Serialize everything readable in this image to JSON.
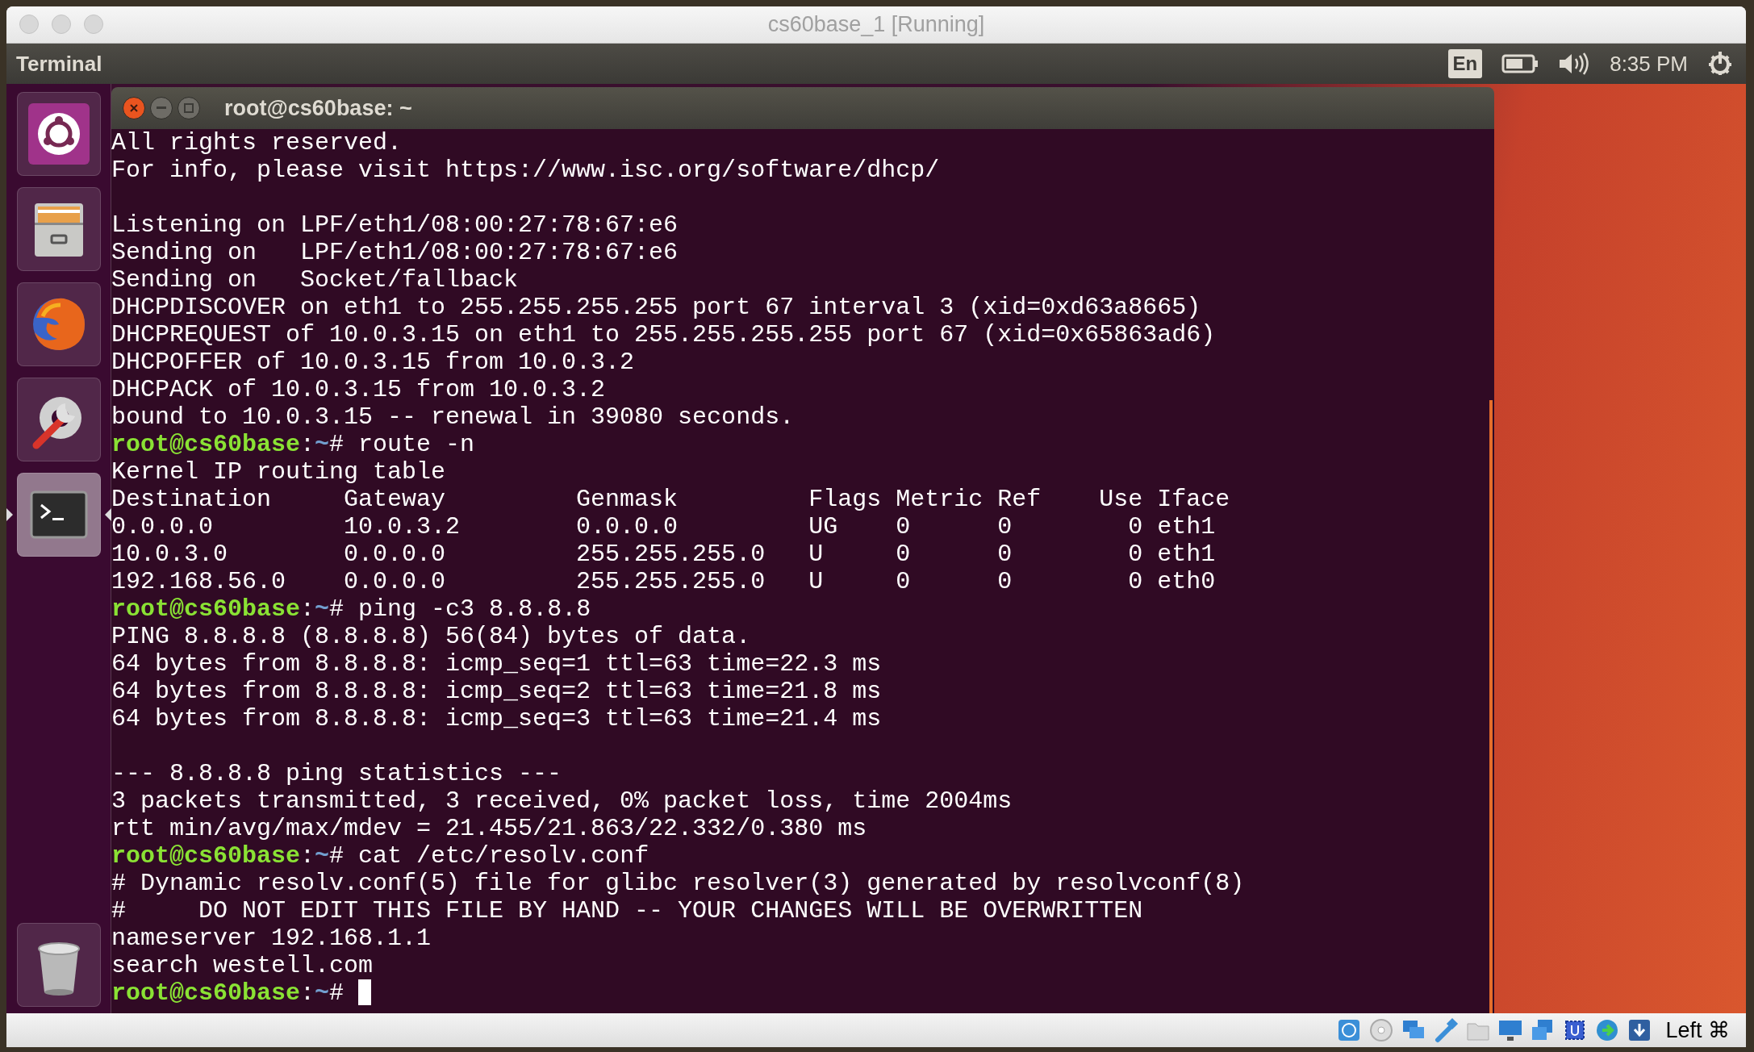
{
  "window": {
    "title": "cs60base_1 [Running]"
  },
  "top_panel": {
    "app_name": "Terminal",
    "keyboard": "En",
    "time": "8:35 PM"
  },
  "launcher": {
    "items": [
      {
        "kind": "dash",
        "selected": false
      },
      {
        "kind": "files",
        "selected": false
      },
      {
        "kind": "browser",
        "selected": false
      },
      {
        "kind": "settings",
        "selected": false
      },
      {
        "kind": "terminal",
        "selected": true
      },
      {
        "kind": "trash",
        "selected": false
      }
    ]
  },
  "terminal": {
    "title": "root@cs60base: ~",
    "lines": [
      {
        "kind": "output",
        "text": "All rights reserved."
      },
      {
        "kind": "output",
        "text": "For info, please visit https://www.isc.org/software/dhcp/"
      },
      {
        "kind": "blank"
      },
      {
        "kind": "output",
        "text": "Listening on LPF/eth1/08:00:27:78:67:e6"
      },
      {
        "kind": "output",
        "text": "Sending on   LPF/eth1/08:00:27:78:67:e6"
      },
      {
        "kind": "output",
        "text": "Sending on   Socket/fallback"
      },
      {
        "kind": "output",
        "text": "DHCPDISCOVER on eth1 to 255.255.255.255 port 67 interval 3 (xid=0xd63a8665)"
      },
      {
        "kind": "output",
        "text": "DHCPREQUEST of 10.0.3.15 on eth1 to 255.255.255.255 port 67 (xid=0x65863ad6)"
      },
      {
        "kind": "output",
        "text": "DHCPOFFER of 10.0.3.15 from 10.0.3.2"
      },
      {
        "kind": "output",
        "text": "DHCPACK of 10.0.3.15 from 10.0.3.2"
      },
      {
        "kind": "output",
        "text": "bound to 10.0.3.15 -- renewal in 39080 seconds."
      },
      {
        "kind": "prompt",
        "user": "root@cs60base",
        "sep": ":",
        "path": "~",
        "mark": "#",
        "text": "route -n"
      },
      {
        "kind": "output",
        "text": "Kernel IP routing table"
      },
      {
        "kind": "output",
        "text": "Destination     Gateway         Genmask         Flags Metric Ref    Use Iface"
      },
      {
        "kind": "output",
        "text": "0.0.0.0         10.0.3.2        0.0.0.0         UG    0      0        0 eth1"
      },
      {
        "kind": "output",
        "text": "10.0.3.0        0.0.0.0         255.255.255.0   U     0      0        0 eth1"
      },
      {
        "kind": "output",
        "text": "192.168.56.0    0.0.0.0         255.255.255.0   U     0      0        0 eth0"
      },
      {
        "kind": "prompt",
        "user": "root@cs60base",
        "sep": ":",
        "path": "~",
        "mark": "#",
        "text": "ping -c3 8.8.8.8"
      },
      {
        "kind": "output",
        "text": "PING 8.8.8.8 (8.8.8.8) 56(84) bytes of data."
      },
      {
        "kind": "output",
        "text": "64 bytes from 8.8.8.8: icmp_seq=1 ttl=63 time=22.3 ms"
      },
      {
        "kind": "output",
        "text": "64 bytes from 8.8.8.8: icmp_seq=2 ttl=63 time=21.8 ms"
      },
      {
        "kind": "output",
        "text": "64 bytes from 8.8.8.8: icmp_seq=3 ttl=63 time=21.4 ms"
      },
      {
        "kind": "blank"
      },
      {
        "kind": "output",
        "text": "--- 8.8.8.8 ping statistics ---"
      },
      {
        "kind": "output",
        "text": "3 packets transmitted, 3 received, 0% packet loss, time 2004ms"
      },
      {
        "kind": "output",
        "text": "rtt min/avg/max/mdev = 21.455/21.863/22.332/0.380 ms"
      },
      {
        "kind": "prompt",
        "user": "root@cs60base",
        "sep": ":",
        "path": "~",
        "mark": "#",
        "text": "cat /etc/resolv.conf"
      },
      {
        "kind": "output",
        "text": "# Dynamic resolv.conf(5) file for glibc resolver(3) generated by resolvconf(8)"
      },
      {
        "kind": "output",
        "text": "#     DO NOT EDIT THIS FILE BY HAND -- YOUR CHANGES WILL BE OVERWRITTEN"
      },
      {
        "kind": "output",
        "text": "nameserver 192.168.1.1"
      },
      {
        "kind": "output",
        "text": "search westell.com"
      },
      {
        "kind": "cursor",
        "user": "root@cs60base",
        "sep": ":",
        "path": "~",
        "mark": "#"
      }
    ]
  },
  "status_bar": {
    "host_key": "Left ⌘"
  }
}
